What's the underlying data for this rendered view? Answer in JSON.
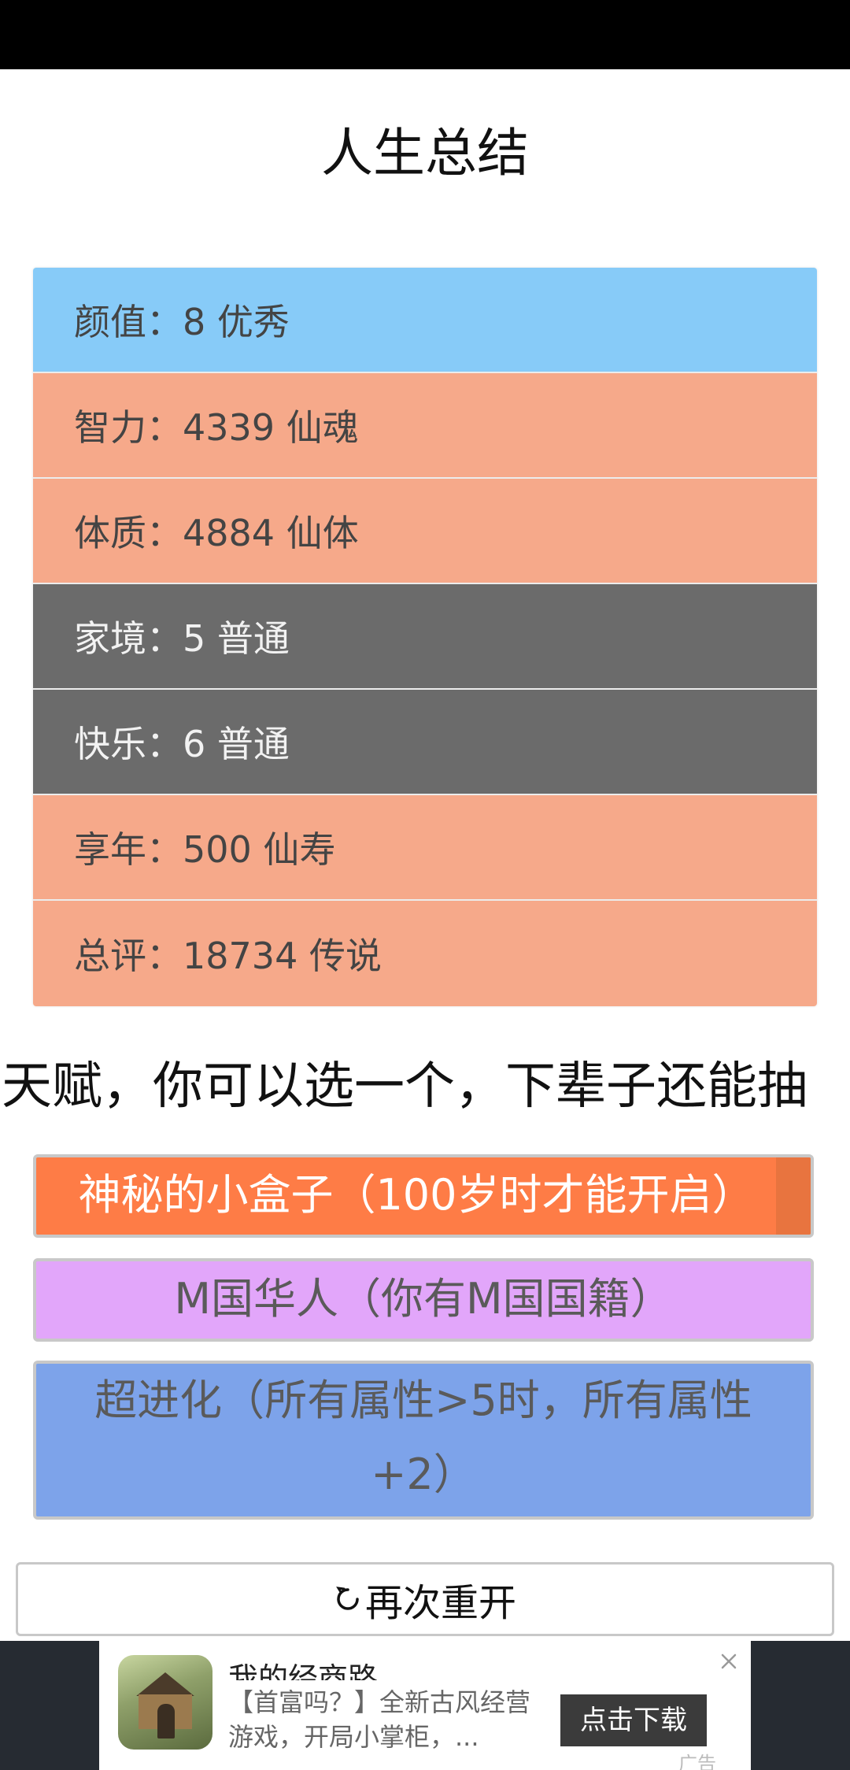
{
  "page": {
    "title": "人生总结"
  },
  "stats": [
    {
      "label": "颜值：8 优秀",
      "color": "#87cbf8"
    },
    {
      "label": "智力：4339 仙魂",
      "color": "#f6a98a"
    },
    {
      "label": "体质：4884 仙体",
      "color": "#f6a98a"
    },
    {
      "label": "家境：5 普通",
      "color": "#6b6b6b"
    },
    {
      "label": "快乐：6 普通",
      "color": "#6b6b6b"
    },
    {
      "label": "享年：500 仙寿",
      "color": "#f6a98a"
    },
    {
      "label": "总评：18734 传说",
      "color": "#f6a98a"
    }
  ],
  "talent_prompt": "天赋，你可以选一个，下辈子还能抽",
  "talents": [
    {
      "label": "神秘的小盒子（100岁时才能开启）",
      "color": "#fe7c46"
    },
    {
      "label": "M国华人（你有M国国籍）",
      "color": "#e2a6fa"
    },
    {
      "label": "超进化（所有属性>5时，所有属性+2）",
      "color": "#7da3ea"
    }
  ],
  "restart": {
    "label": "再次重开",
    "icon": "refresh-icon"
  },
  "ad": {
    "title": "我的经商路",
    "description": "【首富吗？】全新古风经营游戏，开局小掌柜，...",
    "download_label": "点击下载",
    "ad_tag": "广告",
    "close_icon": "close-icon",
    "app_icon": "game-app-icon"
  }
}
